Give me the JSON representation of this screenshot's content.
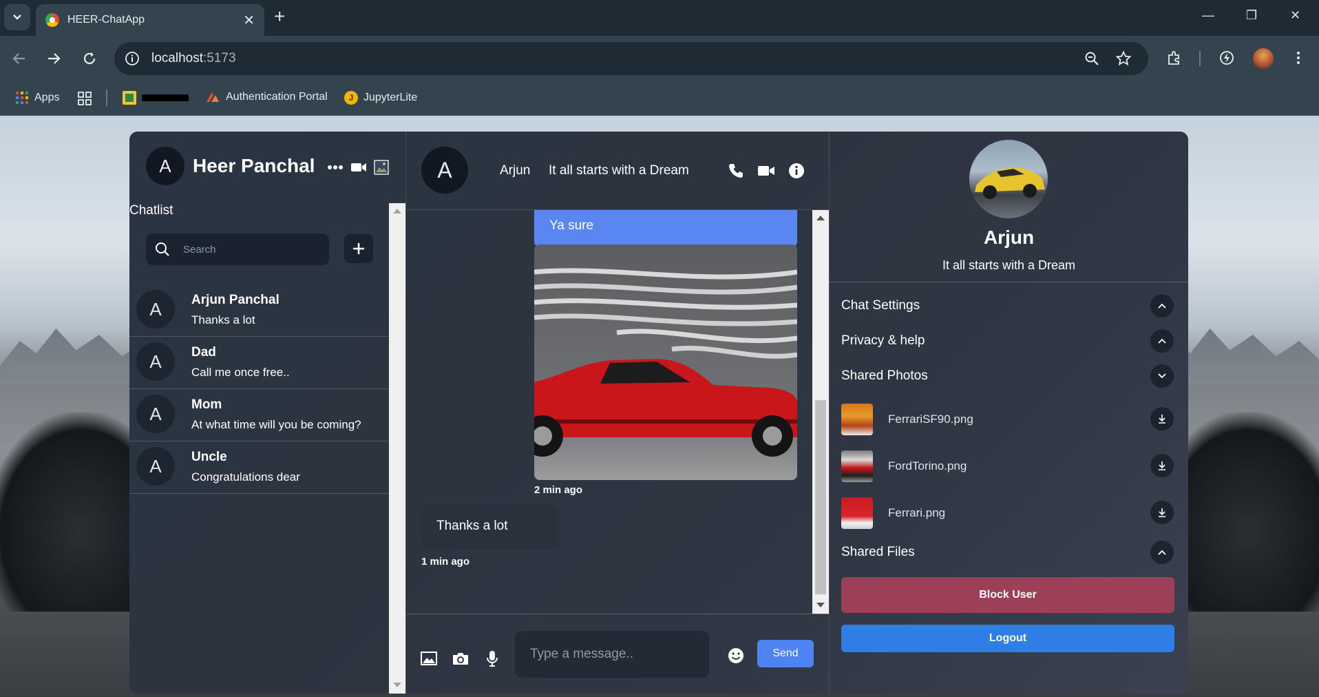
{
  "browser": {
    "tab_title": "HEER-ChatApp",
    "url_host": "localhost",
    "url_port": ":5173",
    "bookmarks": [
      {
        "label": "Apps"
      },
      {
        "label": "Authentication Portal"
      },
      {
        "label": "JupyterLite"
      }
    ]
  },
  "user": {
    "avatar_letter": "A",
    "name": "Heer Panchal"
  },
  "chatlist": {
    "title": "Chatlist",
    "search_placeholder": "Search",
    "chats": [
      {
        "avatar": "A",
        "name": "Arjun Panchal",
        "last_message": "Thanks a lot"
      },
      {
        "avatar": "A",
        "name": "Dad",
        "last_message": "Call me once free.."
      },
      {
        "avatar": "A",
        "name": "Mom",
        "last_message": "At what time will you be coming?"
      },
      {
        "avatar": "A",
        "name": "Uncle",
        "last_message": "Congratulations dear"
      }
    ]
  },
  "conversation": {
    "avatar_letter": "A",
    "contact_name": "Arjun",
    "contact_status": "It all starts with a Dream",
    "messages": [
      {
        "type": "sent_text",
        "text": "Ya sure"
      },
      {
        "type": "sent_image",
        "time": "2 min ago"
      },
      {
        "type": "received_text",
        "text": "Thanks a lot",
        "time": "1 min ago"
      }
    ],
    "composer": {
      "placeholder": "Type a message..",
      "send_label": "Send"
    }
  },
  "details": {
    "name": "Arjun",
    "status": "It all starts with a Dream",
    "sections": {
      "chat_settings": "Chat Settings",
      "privacy": "Privacy & help",
      "shared_photos": "Shared Photos",
      "shared_files": "Shared Files"
    },
    "photos": [
      {
        "name": "FerrariSF90.png"
      },
      {
        "name": "FordTorino.png"
      },
      {
        "name": "Ferrari.png"
      }
    ],
    "block_label": "Block User",
    "logout_label": "Logout"
  }
}
